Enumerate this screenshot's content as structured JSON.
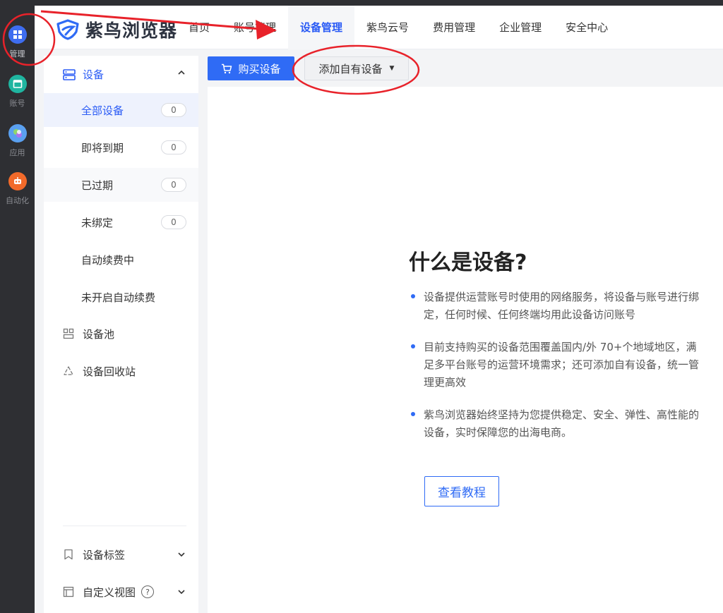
{
  "rail": {
    "items": [
      {
        "label": "管理",
        "icon": "grid-icon"
      },
      {
        "label": "账号",
        "icon": "window-icon"
      },
      {
        "label": "应用",
        "icon": "apps-icon"
      },
      {
        "label": "自动化",
        "icon": "robot-icon"
      }
    ]
  },
  "header": {
    "logo_text": "紫鸟浏览器",
    "nav": [
      {
        "label": "首页"
      },
      {
        "label": "账号管理"
      },
      {
        "label": "设备管理",
        "active": true
      },
      {
        "label": "紫鸟云号"
      },
      {
        "label": "费用管理"
      },
      {
        "label": "企业管理"
      },
      {
        "label": "安全中心"
      }
    ]
  },
  "sidebar": {
    "group_label": "设备",
    "subs": [
      {
        "label": "全部设备",
        "count": "0"
      },
      {
        "label": "即将到期",
        "count": "0"
      },
      {
        "label": "已过期",
        "count": "0"
      },
      {
        "label": "未绑定",
        "count": "0"
      },
      {
        "label": "自动续费中"
      },
      {
        "label": "未开启自动续费"
      }
    ],
    "pool_label": "设备池",
    "recycle_label": "设备回收站",
    "tags_label": "设备标签",
    "custom_view_label": "自定义视图",
    "help_glyph": "?"
  },
  "toolbar": {
    "buy_label": "购买设备",
    "add_label": "添加自有设备"
  },
  "intro": {
    "title": "什么是设备?",
    "bullets": [
      "设备提供运营账号时使用的网络服务，将设备与账号进行绑定，任何时候、任何终端均用此设备访问账号",
      "目前支持购买的设备范围覆盖国内/外 70+个地域地区，满足多平台账号的运营环境需求；还可添加自有设备，统一管理更高效",
      "紫鸟浏览器始终坚持为您提供稳定、安全、弹性、高性能的设备，实时保障您的出海电商。"
    ],
    "tutorial_label": "查看教程"
  },
  "colors": {
    "accent": "#2f6bf5",
    "rail_bg": "#2e2f33",
    "annotation": "#e8222a"
  }
}
